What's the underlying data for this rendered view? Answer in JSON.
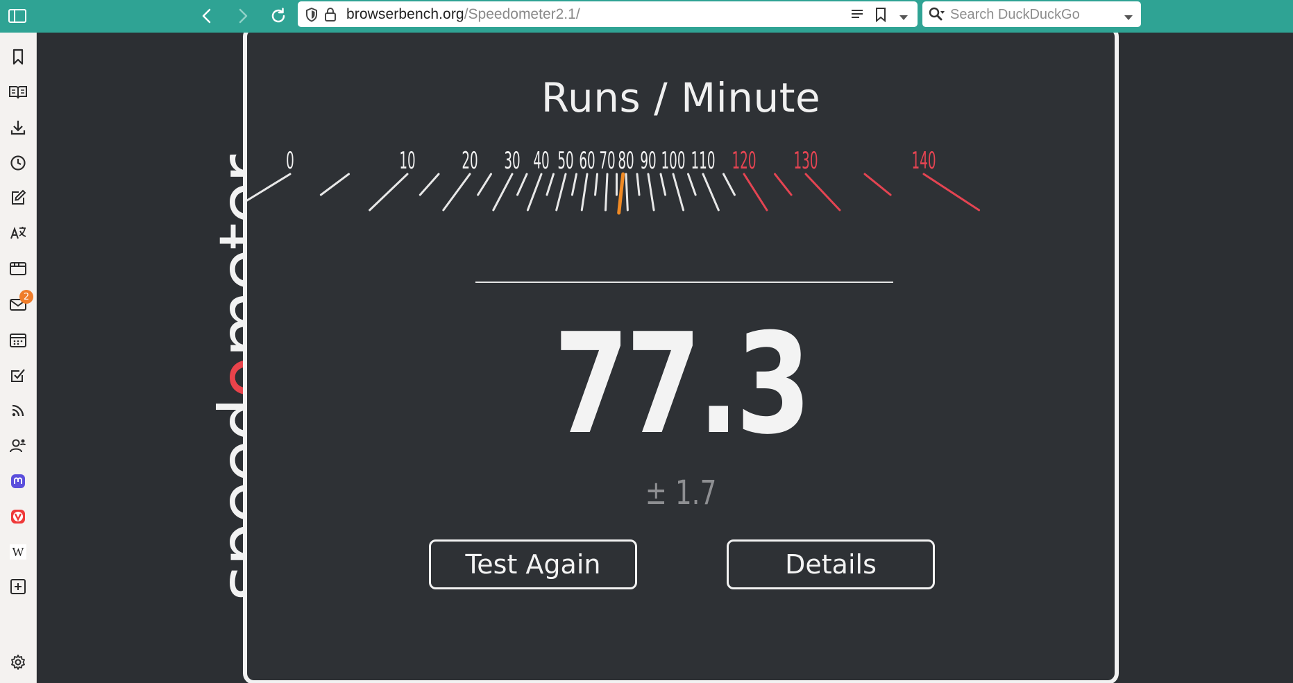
{
  "browser": {
    "url_host": "browserbench.org",
    "url_path": "/Speedometer2.1/",
    "search_placeholder": "Search DuckDuckGo",
    "accent_color": "#2fa394"
  },
  "sidebar": {
    "items": [
      {
        "icon": "bookmark-icon"
      },
      {
        "icon": "reading-list-icon"
      },
      {
        "icon": "download-icon"
      },
      {
        "icon": "history-icon"
      },
      {
        "icon": "notes-icon"
      },
      {
        "icon": "translate-icon"
      },
      {
        "icon": "window-icon"
      },
      {
        "icon": "mail-icon",
        "badge": "2"
      },
      {
        "icon": "calendar-icon"
      },
      {
        "icon": "tasks-icon"
      },
      {
        "icon": "feeds-icon"
      },
      {
        "icon": "contacts-icon"
      },
      {
        "icon": "mastodon-icon"
      },
      {
        "icon": "vivaldi-icon"
      },
      {
        "icon": "wikipedia-icon"
      },
      {
        "icon": "add-panel-icon"
      },
      {
        "icon": "settings-icon"
      }
    ]
  },
  "logo": {
    "text_part1": "speed",
    "text_part2": "o",
    "text_part3": "meter",
    "accent_color": "#e9434b"
  },
  "benchmark": {
    "title": "Runs / Minute",
    "score": "77.3",
    "margin": "± 1.7",
    "gauge_labels": [
      "0",
      "10",
      "20",
      "30",
      "40",
      "50",
      "60",
      "70",
      "80",
      "90",
      "100",
      "110",
      "120",
      "130",
      "140"
    ],
    "needle_value": 77.3,
    "red_zone_start": 120,
    "needle_color": "#f08a24",
    "red_color": "#e44452",
    "buttons": {
      "test_again": "Test Again",
      "details": "Details"
    }
  }
}
